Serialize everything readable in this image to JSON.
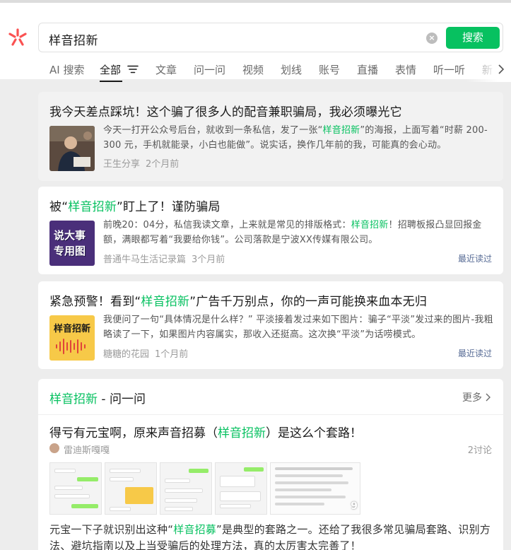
{
  "search": {
    "query": "样音招新",
    "button_label": "搜索"
  },
  "tabs": [
    "AI 搜索",
    "全部",
    "文章",
    "问一问",
    "视频",
    "划线",
    "账号",
    "直播",
    "表情",
    "听一听",
    "新"
  ],
  "results": [
    {
      "title_parts": [
        "我今天差点踩坑！这个骗了很多人的配音兼职骗局，我必须曝光它",
        "",
        ""
      ],
      "snippet_parts": [
        "今天一打开公众号后台，就收到一条私信，发了一张“",
        "样音招新",
        "”的海报，上面写着“时薪 200-300 元，手机就能录，小白也能做”。说实话，换作几年前的我，可能真的会心动。"
      ],
      "source": "王生分享",
      "time": "2个月前",
      "read_label": ""
    },
    {
      "title_parts": [
        "被“",
        "样音招新",
        "”盯上了！谨防骗局"
      ],
      "snippet_parts": [
        "前晚20：04分，私信我读文章，上来就是常见的排版格式：",
        "样音招新",
        "！招聘板报凸显回报金额，满眼都写着“我要给你钱”。公司落款是宁波XX传媒有限公司。"
      ],
      "source": "普通牛马生活记录篇",
      "time": "3个月前",
      "read_label": "最近读过",
      "thumb_text": [
        "说大事",
        "专用图"
      ]
    },
    {
      "title_parts": [
        "紧急预警！看到“",
        "样音招新",
        "”广告千万别点，你的一声可能换来血本无归"
      ],
      "snippet_parts": [
        "我便问了一句“具体情况是什么样？” 平淡接着发过来如下图片：骗子“平淡”发过来的图片-我粗略读了一下，如果图片内容属实，那收入还挺高。这次换“平淡”为话唠模式。",
        "",
        ""
      ],
      "source": "糖糖的花园",
      "time": "1个月前",
      "read_label": "最近读过",
      "thumb_text": [
        "样音招新"
      ]
    }
  ],
  "qa": {
    "heading_keyword": "样音招新",
    "heading_suffix": " - 问一问",
    "more_label": "更多",
    "title_parts": [
      "得亏有元宝啊，原来声音招募（",
      "样音招新",
      "）是这么个套路！"
    ],
    "author": "雷迪斯嘎嘎",
    "discuss": "2讨论",
    "image_count": "9",
    "text_parts": [
      "元宝一下子就识别出这种“",
      "样音招募",
      "”是典型的套路之一。还给了我很多常见骗局套路、识别方法、避坑指南以及上当受骗后的处理方法，真的太厉害太完善了！"
    ]
  },
  "colors": {
    "accent": "#07c160",
    "link": "#576b95",
    "logo": "#fa5151"
  }
}
